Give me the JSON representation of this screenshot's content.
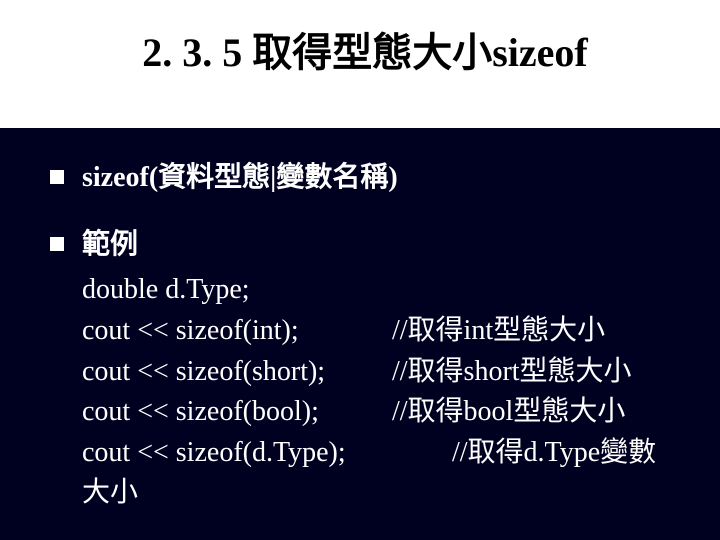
{
  "title": "2. 3. 5  取得型態大小sizeof",
  "bullets": [
    {
      "label": "sizeof(資料型態|變數名稱)"
    },
    {
      "label": "範例",
      "code": [
        {
          "left": "double d.Type;",
          "right": ""
        },
        {
          "left": "cout << sizeof(int);",
          "right": "//取得int型態大小"
        },
        {
          "left": "cout << sizeof(short);",
          "right": "//取得short型態大小"
        },
        {
          "left": "cout << sizeof(bool);",
          "right": "//取得bool型態大小"
        },
        {
          "left": "cout << sizeof(d.Type);",
          "right": "//取得d.Type變數",
          "rightIndent": true
        },
        {
          "left": "大小",
          "right": ""
        }
      ]
    }
  ]
}
